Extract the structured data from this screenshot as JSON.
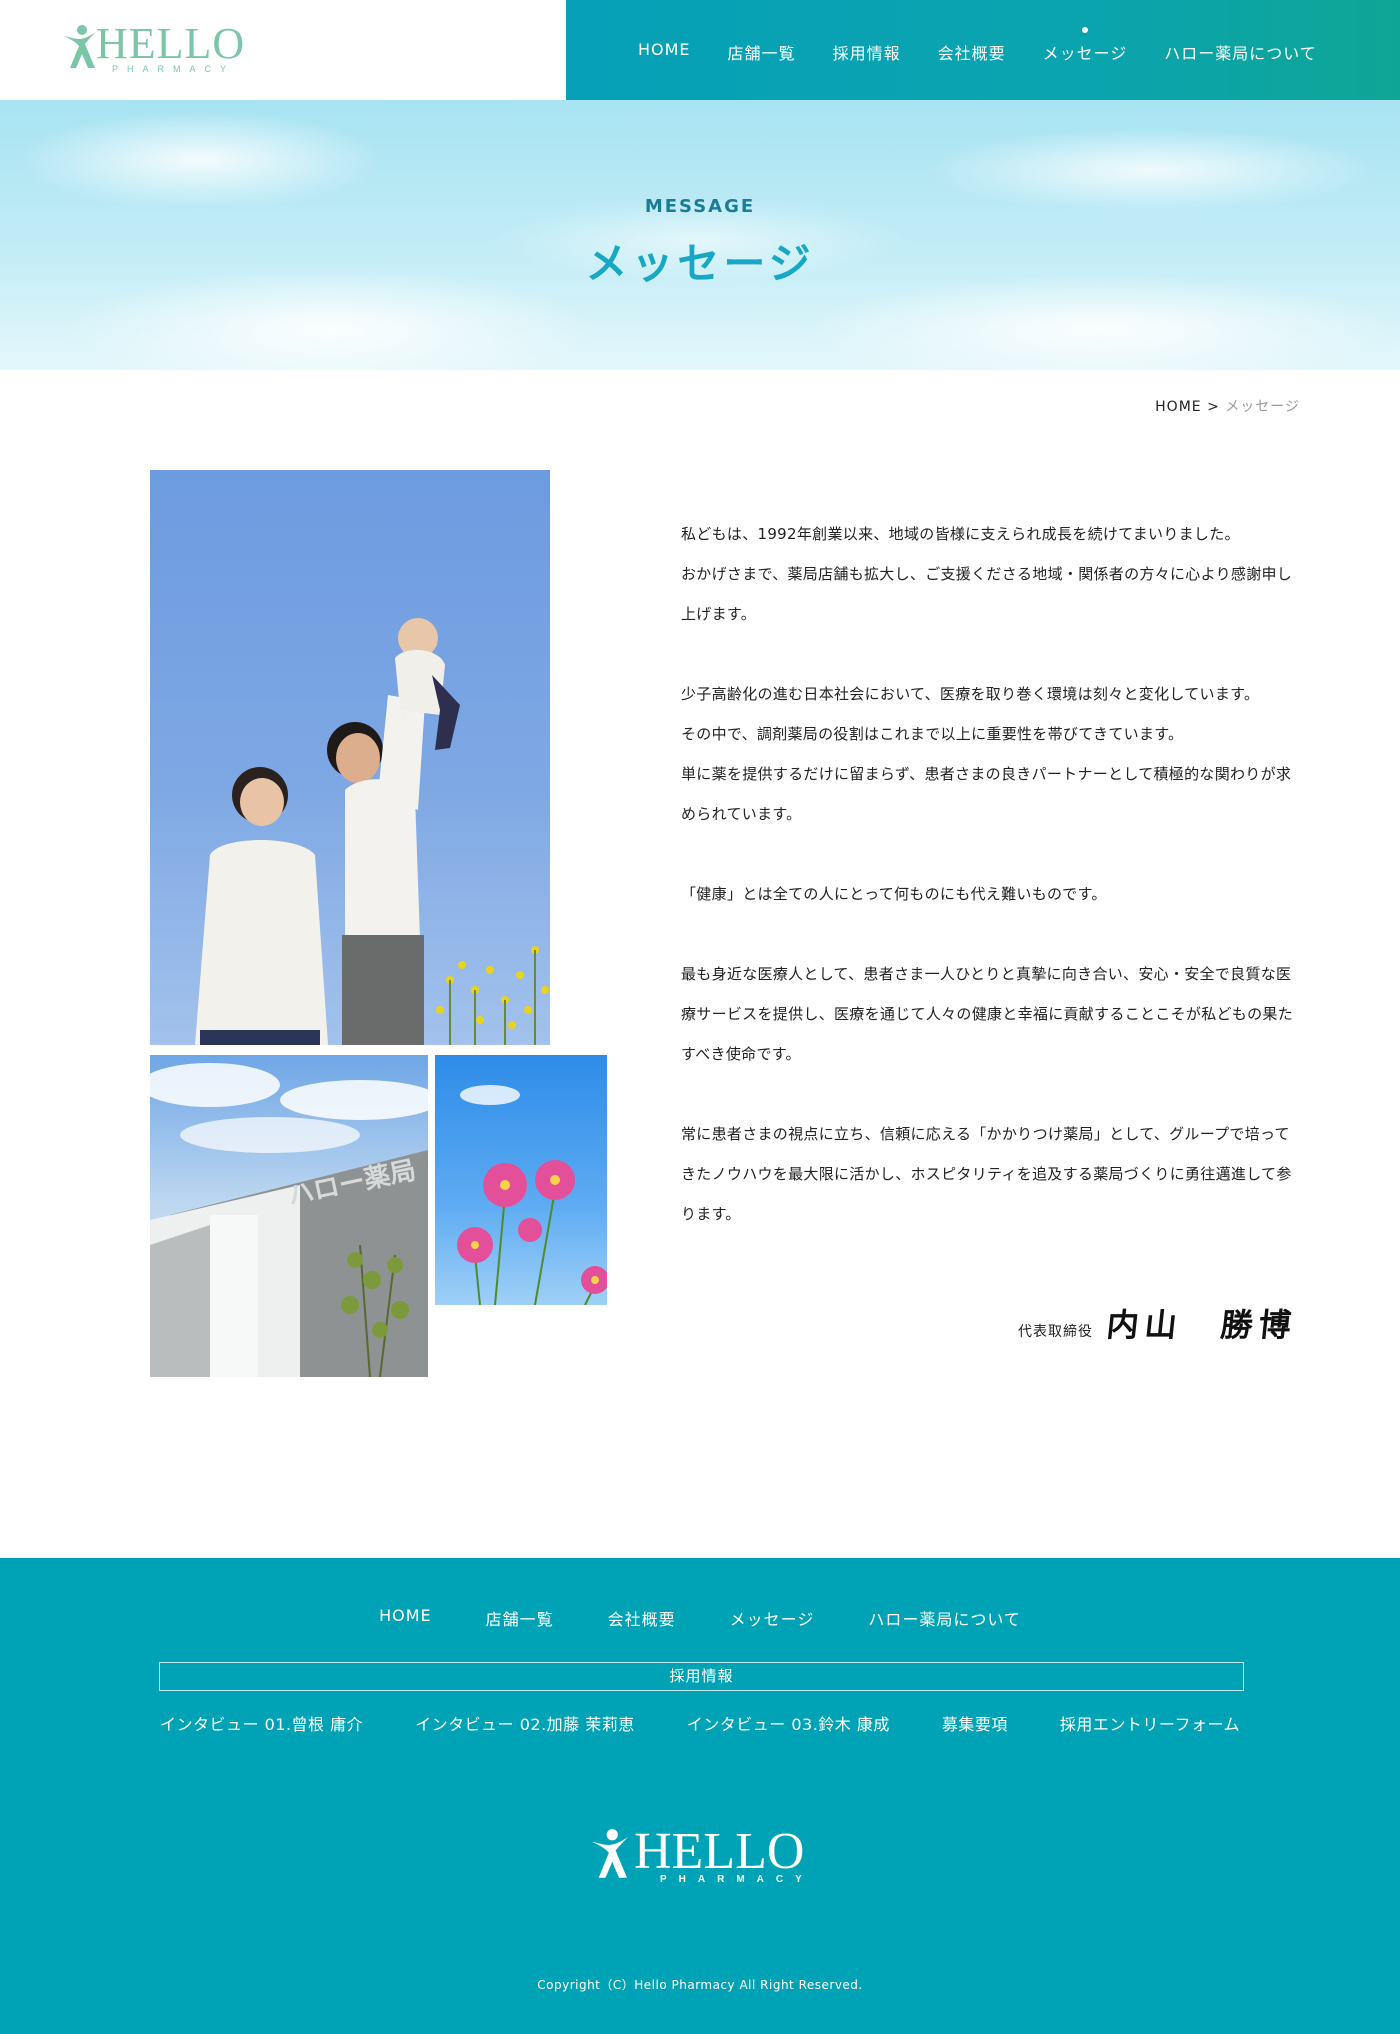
{
  "header": {
    "logo_text": "HELLO",
    "logo_sub": "PHARMACY",
    "nav": [
      "HOME",
      "店舗一覧",
      "採用情報",
      "会社概要",
      "メッセージ",
      "ハロー薬局について"
    ],
    "active_nav": "メッセージ"
  },
  "hero": {
    "title_en": "MESSAGE",
    "title_ja": "メッセージ"
  },
  "breadcrumb": {
    "home": "HOME",
    "separator": ">",
    "current": "メッセージ"
  },
  "message": {
    "paragraphs": [
      "私どもは、1992年創業以来、地域の皆様に支えられ成長を続けてまいりました。\nおかげさまで、薬局店舗も拡大し、ご支援くださる地域・関係者の方々に心より感謝申し上げます。",
      "少子高齢化の進む日本社会において、医療を取り巻く環境は刻々と変化しています。\nその中で、調剤薬局の役割はこれまで以上に重要性を帯びてきています。\n単に薬を提供するだけに留まらず、患者さまの良きパートナーとして積極的な関わりが求められています。",
      "「健康」とは全ての人にとって何ものにも代え難いものです。",
      "最も身近な医療人として、患者さま一人ひとりと真摯に向き合い、安心・安全で良質な医療サービスを提供し、医療を通じて人々の健康と幸福に貢献することこそが私どもの果たすべき使命です。",
      "常に患者さまの視点に立ち、信頼に応える「かかりつけ薬局」として、グループで培ってきたノウハウを最大限に活かし、ホスピタリティを追及する薬局づくりに勇往邁進して参ります。"
    ],
    "signature_role": "代表取締役",
    "signature_name": "内山　勝博"
  },
  "photos": {
    "building_sign": "ハロー薬局"
  },
  "footer": {
    "nav": [
      "HOME",
      "店舗一覧",
      "会社概要",
      "メッセージ",
      "ハロー薬局について"
    ],
    "recruit_label": "採用情報",
    "recruit_links": [
      "インタビュー 01.曾根 庸介",
      "インタビュー 02.加藤 茉莉恵",
      "インタビュー 03.鈴木 康成",
      "募集要項",
      "採用エントリーフォーム"
    ],
    "logo_text": "HELLO",
    "logo_sub": "PHARMACY",
    "copyright": "Copyright（C）Hello Pharmacy All Right Reserved."
  },
  "colors": {
    "nav_bg": "#06a0b8",
    "footer_bg": "#00a3b5",
    "logo": "#7cc6a8",
    "hero_title": "#18a7c4",
    "hero_en": "#1a7c97"
  },
  "icons": {
    "logo_mark": "running-figure-icon"
  }
}
